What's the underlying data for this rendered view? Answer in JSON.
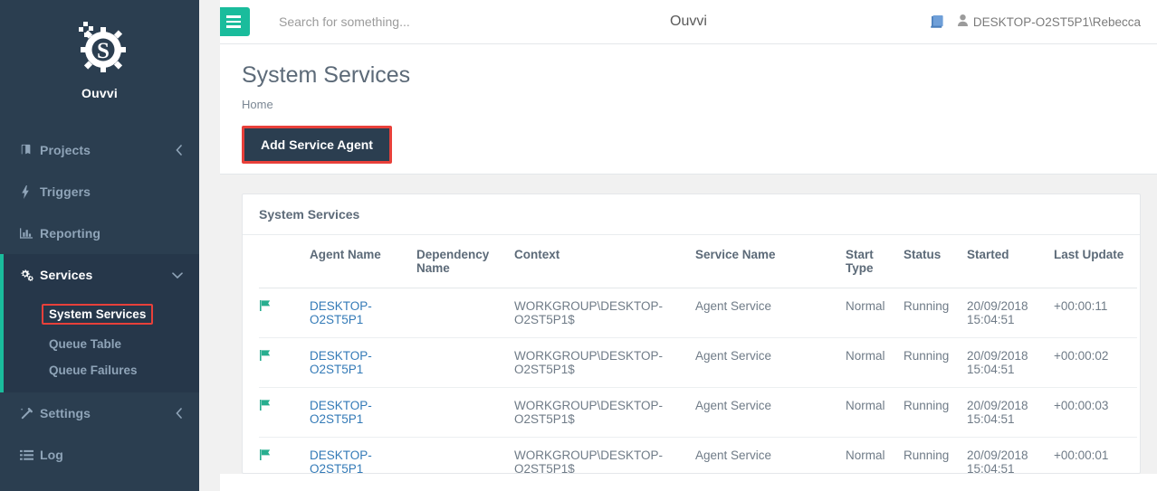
{
  "brand": {
    "name": "Ouvvi",
    "logo_icon": "gear-s-logo"
  },
  "sidebar": {
    "items": [
      {
        "label": "Projects",
        "icon": "book-icon",
        "caret": "chevron-left-icon",
        "active": false
      },
      {
        "label": "Triggers",
        "icon": "bolt-icon",
        "caret": "",
        "active": false
      },
      {
        "label": "Reporting",
        "icon": "chart-bar-icon",
        "caret": "",
        "active": false
      },
      {
        "label": "Services",
        "icon": "gears-icon",
        "caret": "chevron-down-icon",
        "active": true
      },
      {
        "label": "Settings",
        "icon": "magic-wand-icon",
        "caret": "chevron-left-icon",
        "active": false
      },
      {
        "label": "Log",
        "icon": "list-icon",
        "caret": "",
        "active": false
      }
    ],
    "services_subitems": [
      {
        "label": "System Services",
        "selected": true
      },
      {
        "label": "Queue Table",
        "selected": false
      },
      {
        "label": "Queue Failures",
        "selected": false
      }
    ]
  },
  "topbar": {
    "menu_icon": "hamburger-icon",
    "search_placeholder": "Search for something...",
    "search_value": "",
    "title": "Ouvvi",
    "manual_icon": "book-icon",
    "user_icon": "user-icon",
    "username": "DESKTOP-O2ST5P1\\Rebecca"
  },
  "page": {
    "title": "System Services",
    "breadcrumb": "Home",
    "add_button": "Add Service Agent"
  },
  "card": {
    "title": "System Services",
    "columns": [
      "",
      "Agent Name",
      "Dependency Name",
      "Context",
      "Service Name",
      "Start Type",
      "Status",
      "Started",
      "Last Update"
    ],
    "rows": [
      {
        "flag": "flag-icon",
        "agent_name": "DESKTOP-O2ST5P1",
        "dependency_name": "",
        "context": "WORKGROUP\\DESKTOP-O2ST5P1$",
        "service_name": "Agent Service",
        "start_type": "Normal",
        "status": "Running",
        "started": "20/09/2018 15:04:51",
        "last_update": "+00:00:11"
      },
      {
        "flag": "flag-icon",
        "agent_name": "DESKTOP-O2ST5P1",
        "dependency_name": "",
        "context": "WORKGROUP\\DESKTOP-O2ST5P1$",
        "service_name": "Agent Service",
        "start_type": "Normal",
        "status": "Running",
        "started": "20/09/2018 15:04:51",
        "last_update": "+00:00:02"
      },
      {
        "flag": "flag-icon",
        "agent_name": "DESKTOP-O2ST5P1",
        "dependency_name": "",
        "context": "WORKGROUP\\DESKTOP-O2ST5P1$",
        "service_name": "Agent Service",
        "start_type": "Normal",
        "status": "Running",
        "started": "20/09/2018 15:04:51",
        "last_update": "+00:00:03"
      },
      {
        "flag": "flag-icon",
        "agent_name": "DESKTOP-O2ST5P1",
        "dependency_name": "",
        "context": "WORKGROUP\\DESKTOP-O2ST5P1$",
        "service_name": "Agent Service",
        "start_type": "Normal",
        "status": "Running",
        "started": "20/09/2018 15:04:51",
        "last_update": "+00:00:01"
      }
    ]
  },
  "colors": {
    "sidebar_bg": "#2b3e50",
    "accent_teal": "#1abc9c",
    "highlight_red": "#e8403a",
    "link_blue": "#337ab7",
    "flag_green": "#27ae8f"
  }
}
